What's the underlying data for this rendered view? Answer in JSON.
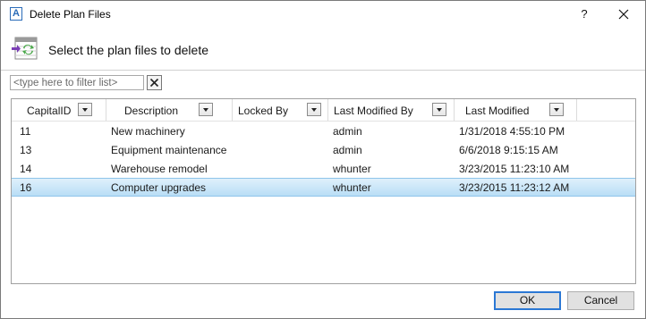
{
  "window": {
    "title": "Delete Plan Files",
    "app_icon_letter": "A",
    "help_label": "?"
  },
  "header": {
    "text": "Select the plan files to delete"
  },
  "filter": {
    "placeholder": "<type here to filter list>",
    "value": ""
  },
  "grid": {
    "columns": [
      {
        "key": "capital_id",
        "label": "CapitalID"
      },
      {
        "key": "description",
        "label": "Description"
      },
      {
        "key": "locked_by",
        "label": "Locked By"
      },
      {
        "key": "last_modified_by",
        "label": "Last Modified By"
      },
      {
        "key": "last_modified",
        "label": "Last Modified"
      }
    ],
    "rows": [
      {
        "capital_id": "11",
        "description": "New machinery",
        "locked_by": "",
        "last_modified_by": "admin",
        "last_modified": "1/31/2018 4:55:10 PM",
        "selected": false
      },
      {
        "capital_id": "13",
        "description": "Equipment maintenance",
        "locked_by": "",
        "last_modified_by": "admin",
        "last_modified": "6/6/2018 9:15:15 AM",
        "selected": false
      },
      {
        "capital_id": "14",
        "description": "Warehouse remodel",
        "locked_by": "",
        "last_modified_by": "whunter",
        "last_modified": "3/23/2015 11:23:10 AM",
        "selected": false
      },
      {
        "capital_id": "16",
        "description": "Computer upgrades",
        "locked_by": "",
        "last_modified_by": "whunter",
        "last_modified": "3/23/2015 11:23:12 AM",
        "selected": true
      }
    ]
  },
  "buttons": {
    "ok": "OK",
    "cancel": "Cancel"
  },
  "colors": {
    "accent": "#2b78d4",
    "selection": "#b9def6",
    "icon_green": "#4aa84a",
    "icon_purple": "#7b3fb5"
  }
}
